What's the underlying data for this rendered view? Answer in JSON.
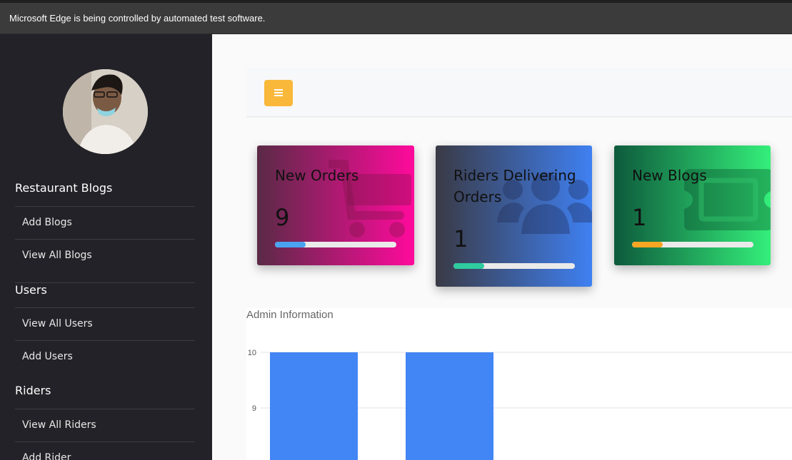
{
  "browser": {
    "automation_notice": "Microsoft Edge is being controlled by automated test software."
  },
  "sidebar": {
    "sections": [
      {
        "title": "Restaurant Blogs",
        "items": [
          "Add Blogs",
          "View All Blogs"
        ]
      },
      {
        "title": "Users",
        "items": [
          "View All Users",
          "Add Users"
        ]
      },
      {
        "title": "Riders",
        "items": [
          "View All Riders",
          "Add Rider"
        ]
      }
    ]
  },
  "header": {
    "menu_icon": "bars-icon",
    "menu_color": "#f9b83a"
  },
  "cards": [
    {
      "title": "New Orders",
      "value": "9",
      "icon": "shopping-cart-icon",
      "progress": 0.25,
      "progress_color": "#4aa3f0",
      "gradient": [
        "#5a2a46",
        "#ff0a9c"
      ]
    },
    {
      "title": "Riders Delivering Orders",
      "value": "1",
      "icon": "users-icon",
      "progress": 0.25,
      "progress_color": "#2ecc9f",
      "gradient": [
        "#3a3a45",
        "#3f80f2"
      ]
    },
    {
      "title": "New Blogs",
      "value": "1",
      "icon": "ticket-icon",
      "progress": 0.25,
      "progress_color": "#f5a623",
      "gradient": [
        "#0e5a3c",
        "#34ef7a"
      ]
    }
  ],
  "chart_data": {
    "type": "bar",
    "title": "Admin Information",
    "categories": [
      "",
      ""
    ],
    "values": [
      10,
      10
    ],
    "y_ticks": [
      "10",
      "9"
    ],
    "ylim": [
      8,
      10
    ],
    "bar_color": "#4285f4",
    "grid": true
  }
}
